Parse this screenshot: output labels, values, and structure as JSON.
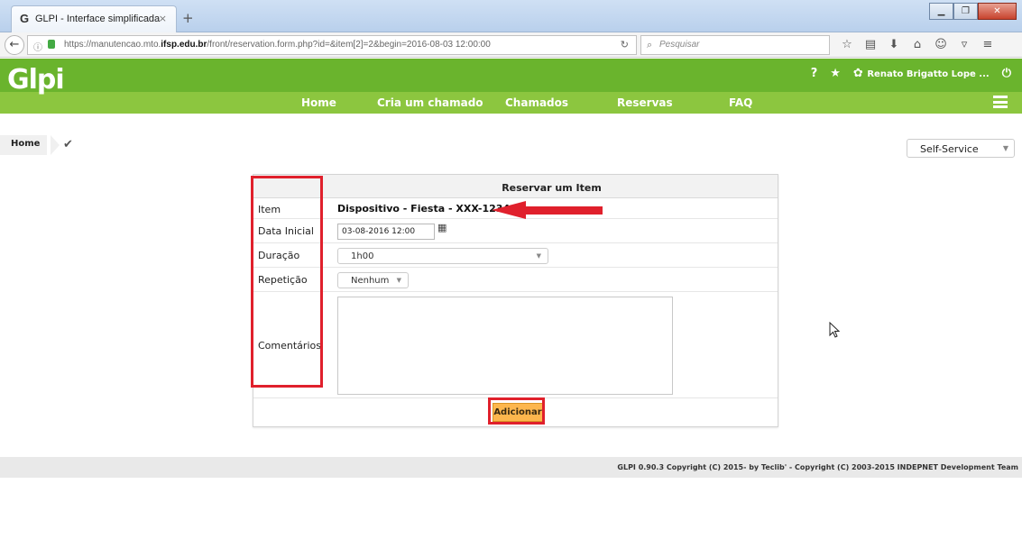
{
  "browser": {
    "tab_title": "GLPI - Interface simplificada",
    "tab_icon": "G",
    "tab_close": "×",
    "new_tab": "+",
    "url_host_prefix": "https://manutencao.mto.",
    "url_host_bold": "ifsp.edu.br",
    "url_path": "/front/reservation.form.php?id=&item[2]=2&begin=2016-08-03 12:00:00",
    "search_placeholder": "Pesquisar"
  },
  "header": {
    "logo": "Glpi",
    "help_icon": "?",
    "star_icon": "★",
    "gear_icon": "✿",
    "user_name": "Renato Brigatto Lope ...",
    "logout_icon": "⏻"
  },
  "menu": {
    "items": [
      "Home",
      "Cria um chamado",
      "Chamados",
      "Reservas",
      "FAQ"
    ]
  },
  "breadcrumb": {
    "home": "Home",
    "profile": "Self-Service"
  },
  "form": {
    "title": "Reservar um Item",
    "labels": {
      "item": "Item",
      "start": "Data Inicial",
      "duration": "Duração",
      "repeat": "Repetição",
      "comments": "Comentários"
    },
    "item_value": "Dispositivo - Fiesta - XXX-1234",
    "start_value": "03-08-2016 12:00",
    "duration_value": "1h00",
    "repeat_value": "Nenhum",
    "submit": "Adicionar"
  },
  "footer": {
    "text": "GLPI 0.90.3 Copyright (C) 2015- by Teclib' - Copyright (C) 2003-2015 INDEPNET Development Team"
  },
  "colors": {
    "header_green": "#6ab42d",
    "menu_green": "#8cc63f",
    "submit_orange": "#fdb64d",
    "annotation_red": "#e0202c"
  }
}
